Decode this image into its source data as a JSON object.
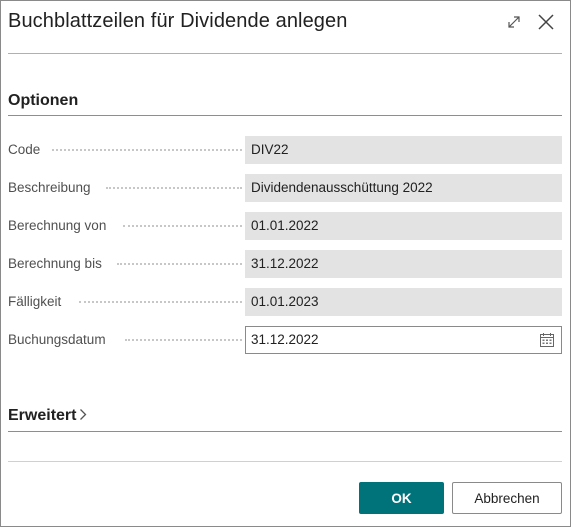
{
  "dialog": {
    "title": "Buchblattzeilen für Dividende anlegen",
    "expand_icon": "expand-diagonal-icon",
    "close_icon": "close-icon"
  },
  "sections": {
    "options": {
      "title": "Optionen"
    },
    "advanced": {
      "title": "Erweitert",
      "chevron_icon": "chevron-right-icon"
    }
  },
  "fields": [
    {
      "label": "Code",
      "value": "DIV22",
      "editable": false
    },
    {
      "label": "Beschreibung",
      "value": "Dividendenausschüttung 2022",
      "editable": false
    },
    {
      "label": "Berechnung von",
      "value": "01.01.2022",
      "editable": false
    },
    {
      "label": "Berechnung bis",
      "value": "31.12.2022",
      "editable": false
    },
    {
      "label": "Fälligkeit",
      "value": "01.01.2023",
      "editable": false
    },
    {
      "label": "Buchungsdatum",
      "value": "31.12.2022",
      "editable": true,
      "icon": "calendar-icon"
    }
  ],
  "buttons": {
    "ok": "OK",
    "cancel": "Abbrechen"
  },
  "colors": {
    "primary": "#00727a",
    "readonly_field": "#e3e3e3"
  }
}
